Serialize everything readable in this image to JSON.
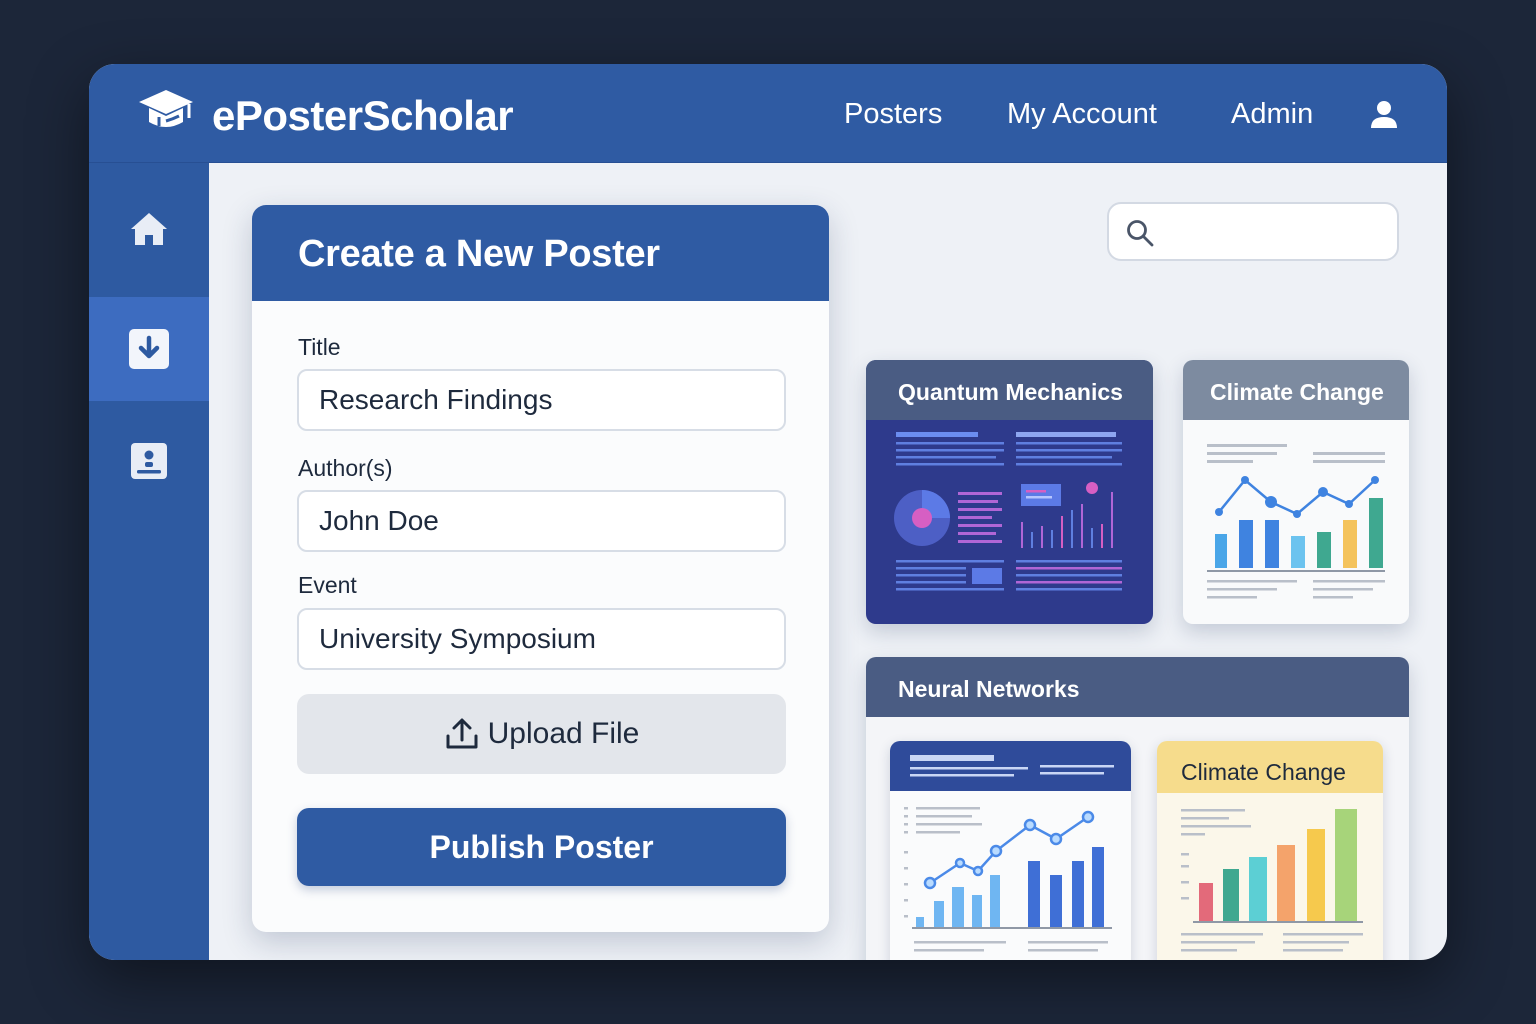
{
  "app": {
    "brand": "ePosterScholar",
    "nav": [
      "Posters",
      "My Account",
      "Admin"
    ]
  },
  "sidebar": {
    "items": [
      {
        "name": "home",
        "icon": "home-icon"
      },
      {
        "name": "download",
        "icon": "download-icon",
        "active": true
      },
      {
        "name": "profile",
        "icon": "profile-icon"
      }
    ]
  },
  "form": {
    "heading": "Create a New Poster",
    "title_label": "Title",
    "title_value": "Research Findings",
    "authors_label": "Author(s)",
    "authors_value": "John Doe",
    "event_label": "Event",
    "event_value": "University Symposium",
    "upload_label": "Upload File",
    "publish_label": "Publish Poster"
  },
  "search": {
    "placeholder": ""
  },
  "posters": {
    "quantum": "Quantum Mechanics",
    "climate": "Climate Change",
    "neural": "Neural Networks",
    "neural_sub_climate": "Climate Change"
  },
  "colors": {
    "primary": "#2f5ba3",
    "sidebar_active": "#3d6cc0",
    "background": "#1c2639"
  }
}
